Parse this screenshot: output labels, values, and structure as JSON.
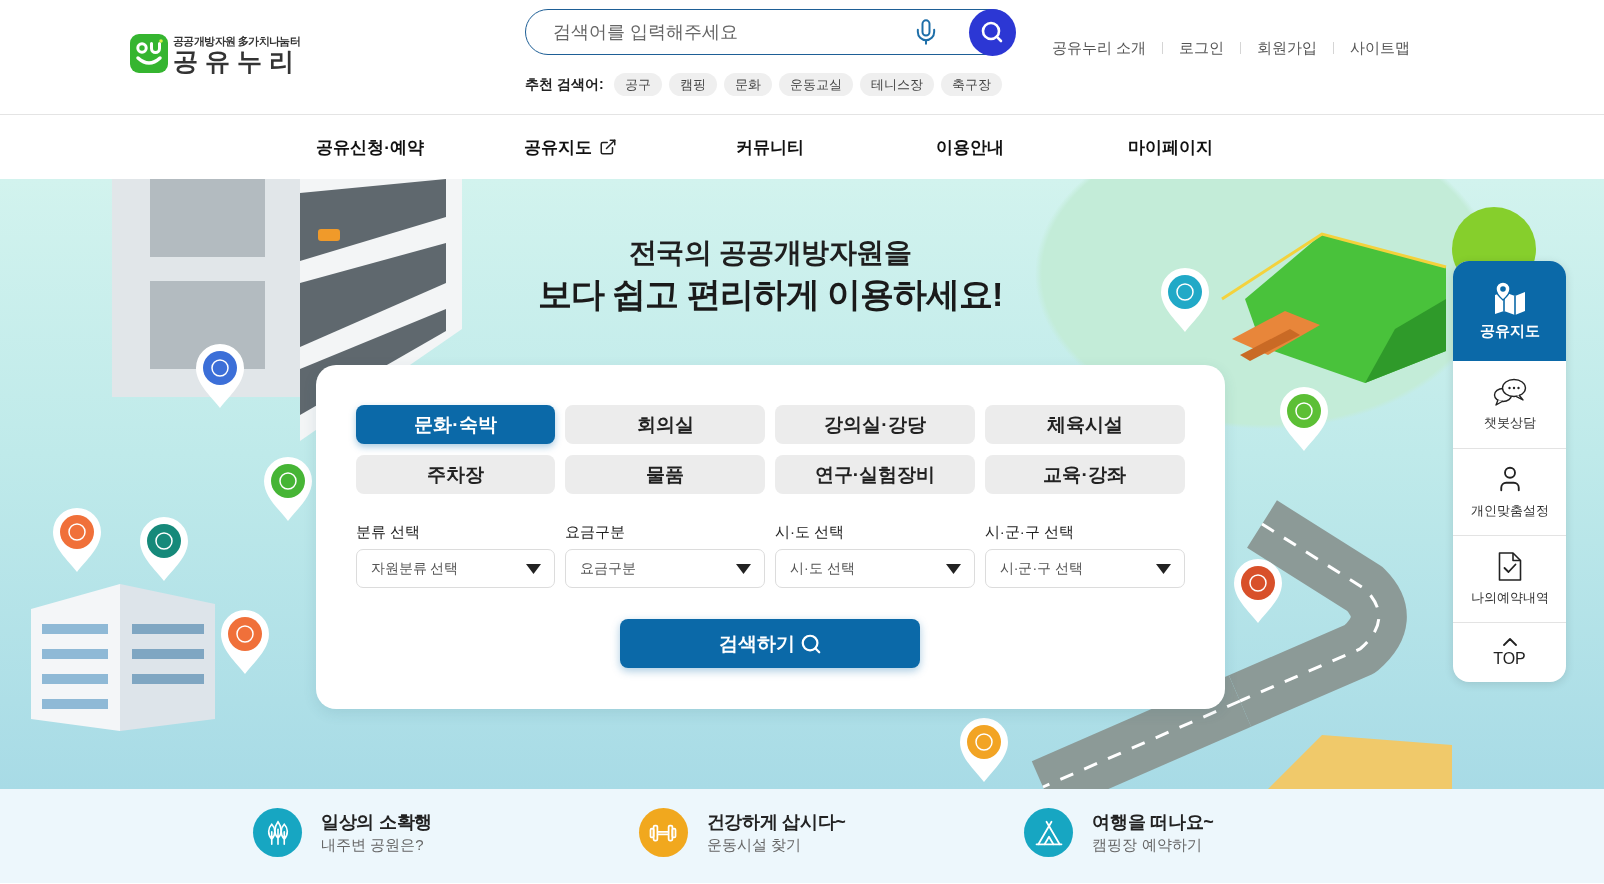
{
  "header": {
    "logo": {
      "tagline": "공공개방자원 多가치나눔터",
      "wordmark": "공 유 누 리"
    },
    "search": {
      "placeholder": "검색어를 입력해주세요"
    },
    "recommended": {
      "label": "추천 검색어:",
      "keywords": [
        "공구",
        "캠핑",
        "문화",
        "운동교실",
        "테니스장",
        "축구장"
      ]
    },
    "utility_links": [
      "공유누리 소개",
      "로그인",
      "회원가입",
      "사이트맵"
    ]
  },
  "nav": [
    {
      "label": "공유신청·예약",
      "external": false
    },
    {
      "label": "공유지도",
      "external": true
    },
    {
      "label": "커뮤니티",
      "external": false
    },
    {
      "label": "이용안내",
      "external": false
    },
    {
      "label": "마이페이지",
      "external": false
    }
  ],
  "hero": {
    "title_line_1": "전국의 공공개방자원을",
    "title_line_2": "보다 쉽고 편리하게 이용하세요!"
  },
  "search_panel": {
    "categories": [
      {
        "label": "문화·숙박",
        "selected": true
      },
      {
        "label": "회의실",
        "selected": false
      },
      {
        "label": "강의실·강당",
        "selected": false
      },
      {
        "label": "체육시설",
        "selected": false
      },
      {
        "label": "주차장",
        "selected": false
      },
      {
        "label": "물품",
        "selected": false
      },
      {
        "label": "연구·실험장비",
        "selected": false
      },
      {
        "label": "교육·강좌",
        "selected": false
      }
    ],
    "filters": [
      {
        "label": "분류 선택",
        "value": "자원분류 선택"
      },
      {
        "label": "요금구분",
        "value": "요금구분"
      },
      {
        "label": "시·도 선택",
        "value": "시·도 선택"
      },
      {
        "label": "시·군·구 선택",
        "value": "시·군·구 선택"
      }
    ],
    "submit": "검색하기"
  },
  "quick_menu": [
    {
      "kind": "featured",
      "label": "공유지도"
    },
    {
      "kind": "link",
      "label": "챗봇상담"
    },
    {
      "kind": "link",
      "label": "개인맞춤설정"
    },
    {
      "kind": "link",
      "label": "나의예약내역"
    },
    {
      "kind": "top",
      "label": "TOP"
    }
  ],
  "shortcuts": [
    {
      "title": "일상의 소확행",
      "subtitle": "내주변 공원은?",
      "color": "#17a6c2"
    },
    {
      "title": "건강하게 삽시다~",
      "subtitle": "운동시설 찾기",
      "color": "#f1a81e"
    },
    {
      "title": "여행을 떠나요~",
      "subtitle": "캠핑장 예약하기",
      "color": "#17a6c2"
    }
  ]
}
